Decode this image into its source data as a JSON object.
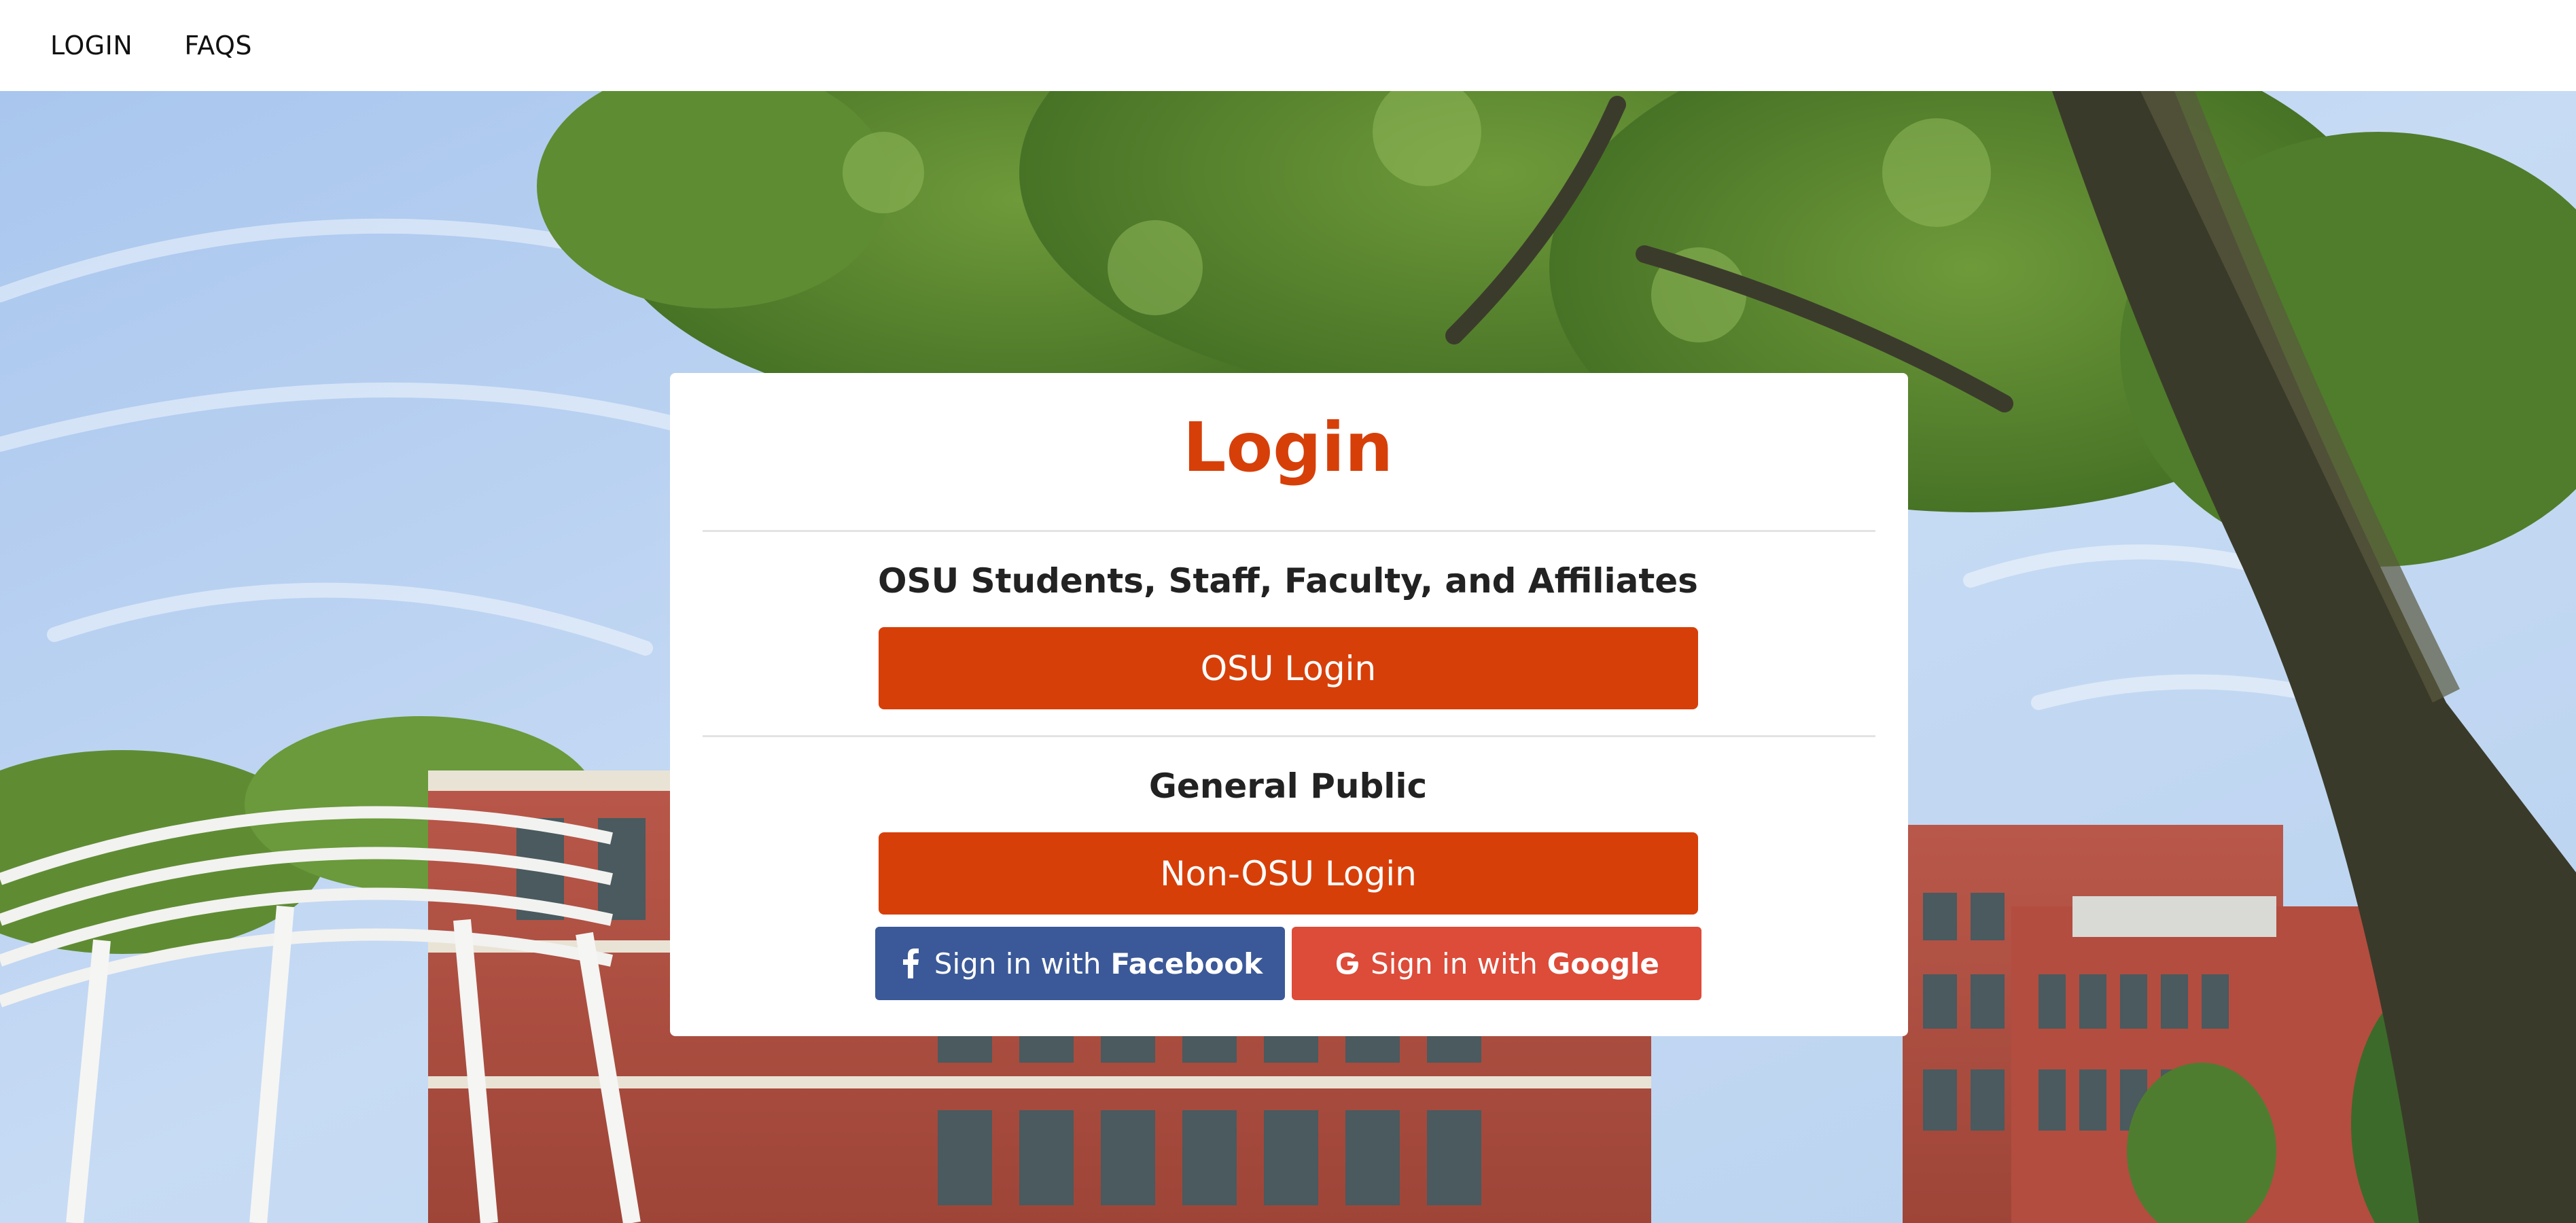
{
  "nav": {
    "items": [
      {
        "label": "LOGIN"
      },
      {
        "label": "FAQS"
      }
    ]
  },
  "card": {
    "title": "Login",
    "osu_section": {
      "label": "OSU Students, Staff, Faculty, and Affiliates",
      "button_label": "OSU Login"
    },
    "public_section": {
      "label": "General Public",
      "button_label": "Non-OSU Login"
    },
    "social": {
      "facebook": {
        "prefix": "Sign in with",
        "brand": "Facebook",
        "icon": "facebook-f-icon"
      },
      "google": {
        "prefix": "Sign in with",
        "brand": "Google",
        "icon": "google-g-icon"
      }
    }
  },
  "colors": {
    "accent": "#d73f09",
    "facebook": "#3b5998",
    "google": "#dd4b39"
  }
}
